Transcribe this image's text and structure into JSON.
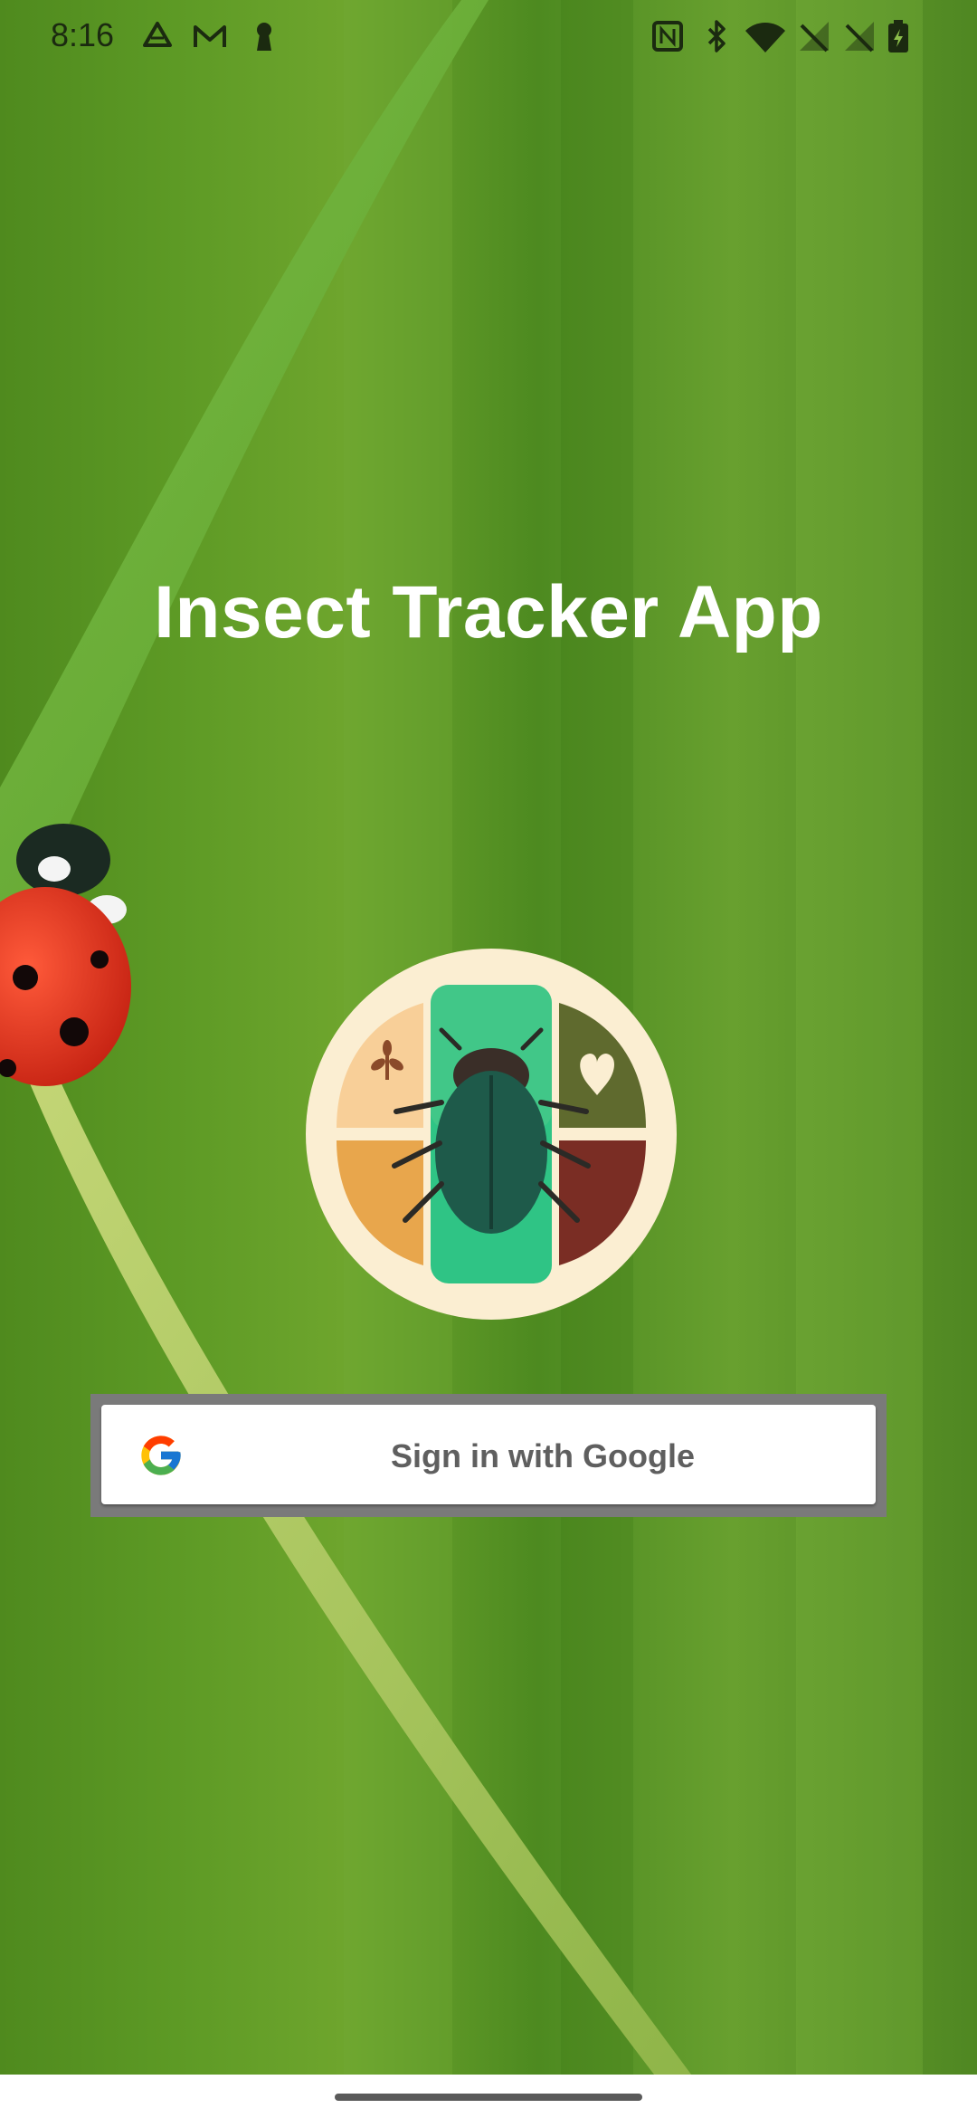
{
  "status_bar": {
    "time": "8:16",
    "left_icons": [
      "drive-icon",
      "gmail-icon",
      "keyhole-icon"
    ],
    "right_icons": [
      "nfc-icon",
      "bluetooth-icon",
      "wifi-icon",
      "no-signal-icon",
      "no-signal-icon",
      "battery-charging-icon"
    ]
  },
  "app": {
    "title": "Insect Tracker App",
    "logo": "insect-tracker-logo"
  },
  "signin": {
    "label": "Sign in with Google",
    "icon": "google-icon"
  },
  "nav": {
    "handle": "home-gesture-handle"
  },
  "colors": {
    "background_green": "#5d9a25",
    "title_text": "#ffffff",
    "button_bg": "#ffffff",
    "button_text": "#5f5f5f",
    "button_frame": "#7a7a7a"
  }
}
